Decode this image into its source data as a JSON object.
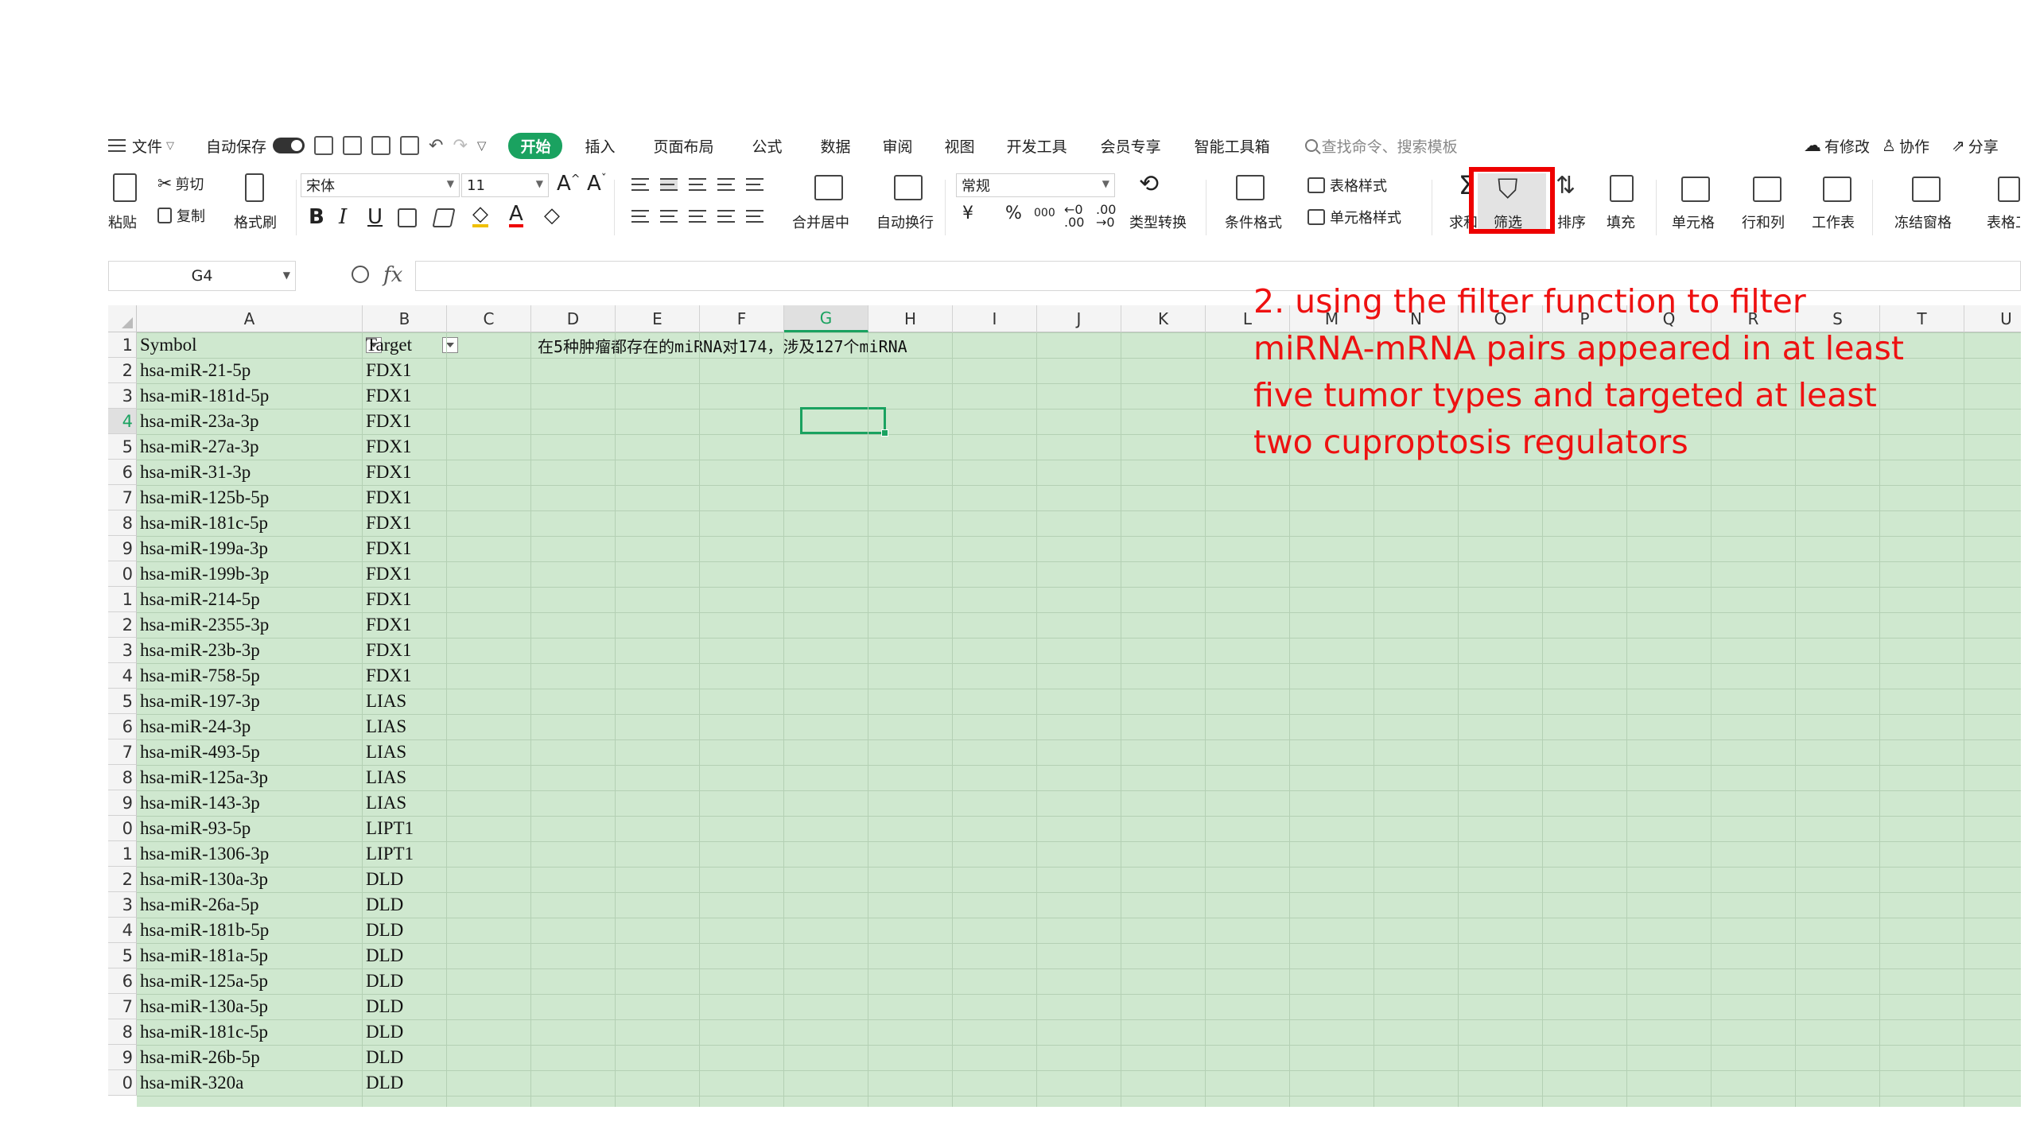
{
  "menubar": {
    "file": "文件",
    "autosave": "自动保存",
    "tabs": [
      "开始",
      "插入",
      "页面布局",
      "公式",
      "数据",
      "审阅",
      "视图",
      "开发工具",
      "会员专享",
      "智能工具箱"
    ],
    "search_placeholder": "查找命令、搜索模板",
    "modified": "有修改",
    "collab": "协作",
    "share": "分享"
  },
  "ribbon": {
    "paste": "粘贴",
    "cut": "剪切",
    "copy": "复制",
    "format_painter": "格式刷",
    "font_name": "宋体",
    "font_size": "11",
    "merge_center": "合并居中",
    "wrap_text": "自动换行",
    "number_format": "常规",
    "type_convert": "类型转换",
    "cond_format": "条件格式",
    "table_style": "表格样式",
    "cell_style": "单元格样式",
    "sum": "求和",
    "filter": "筛选",
    "sort": "排序",
    "fill": "填充",
    "cell": "单元格",
    "row_col": "行和列",
    "worksheet": "工作表",
    "freeze": "冻结窗格",
    "table_tools": "表格工具",
    "bold": "B",
    "italic": "I",
    "underline": "U",
    "currency": "¥",
    "percent": "%",
    "thousands": "000"
  },
  "formula_bar": {
    "name_box": "G4",
    "fx": "fx",
    "value": ""
  },
  "sheet": {
    "columns": [
      "A",
      "B",
      "C",
      "D",
      "E",
      "F",
      "G",
      "H",
      "I",
      "J",
      "K",
      "L",
      "M",
      "N",
      "O",
      "P",
      "Q",
      "R",
      "S",
      "T",
      "U"
    ],
    "row_numbers": [
      "1",
      "2",
      "3",
      "4",
      "5",
      "6",
      "7",
      "8",
      "9",
      "0",
      "1",
      "2",
      "3",
      "4",
      "5",
      "6",
      "7",
      "8",
      "9",
      "0",
      "1",
      "2",
      "3",
      "4",
      "5",
      "6",
      "7",
      "8",
      "9",
      "0"
    ],
    "headers": [
      "Symbol",
      "Target"
    ],
    "rows": [
      [
        "hsa-miR-21-5p",
        "FDX1"
      ],
      [
        "hsa-miR-181d-5p",
        "FDX1"
      ],
      [
        "hsa-miR-23a-3p",
        "FDX1"
      ],
      [
        "hsa-miR-27a-3p",
        "FDX1"
      ],
      [
        "hsa-miR-31-3p",
        "FDX1"
      ],
      [
        "hsa-miR-125b-5p",
        "FDX1"
      ],
      [
        "hsa-miR-181c-5p",
        "FDX1"
      ],
      [
        "hsa-miR-199a-3p",
        "FDX1"
      ],
      [
        "hsa-miR-199b-3p",
        "FDX1"
      ],
      [
        "hsa-miR-214-5p",
        "FDX1"
      ],
      [
        "hsa-miR-2355-3p",
        "FDX1"
      ],
      [
        "hsa-miR-23b-3p",
        "FDX1"
      ],
      [
        "hsa-miR-758-5p",
        "FDX1"
      ],
      [
        "hsa-miR-197-3p",
        "LIAS"
      ],
      [
        "hsa-miR-24-3p",
        "LIAS"
      ],
      [
        "hsa-miR-493-5p",
        "LIAS"
      ],
      [
        "hsa-miR-125a-3p",
        "LIAS"
      ],
      [
        "hsa-miR-143-3p",
        "LIAS"
      ],
      [
        "hsa-miR-93-5p",
        "LIPT1"
      ],
      [
        "hsa-miR-1306-3p",
        "LIPT1"
      ],
      [
        "hsa-miR-130a-3p",
        "DLD"
      ],
      [
        "hsa-miR-26a-5p",
        "DLD"
      ],
      [
        "hsa-miR-181b-5p",
        "DLD"
      ],
      [
        "hsa-miR-181a-5p",
        "DLD"
      ],
      [
        "hsa-miR-125a-5p",
        "DLD"
      ],
      [
        "hsa-miR-130a-5p",
        "DLD"
      ],
      [
        "hsa-miR-181c-5p",
        "DLD"
      ],
      [
        "hsa-miR-26b-5p",
        "DLD"
      ],
      [
        "hsa-miR-320a",
        "DLD"
      ]
    ],
    "note_d1": "在5种肿瘤都存在的miRNA对174，涉及127个miRNA",
    "active_cell": "G4"
  },
  "annotation": "2. using the filter function to filter miRNA-mRNA pairs appeared in at least five tumor types and targeted at least two cuproptosis regulators",
  "colors": {
    "accent_green": "#1aa260",
    "cell_fill": "#cfe8cf",
    "annotation_red": "#ee1111",
    "highlight_red": "#ee0000"
  }
}
